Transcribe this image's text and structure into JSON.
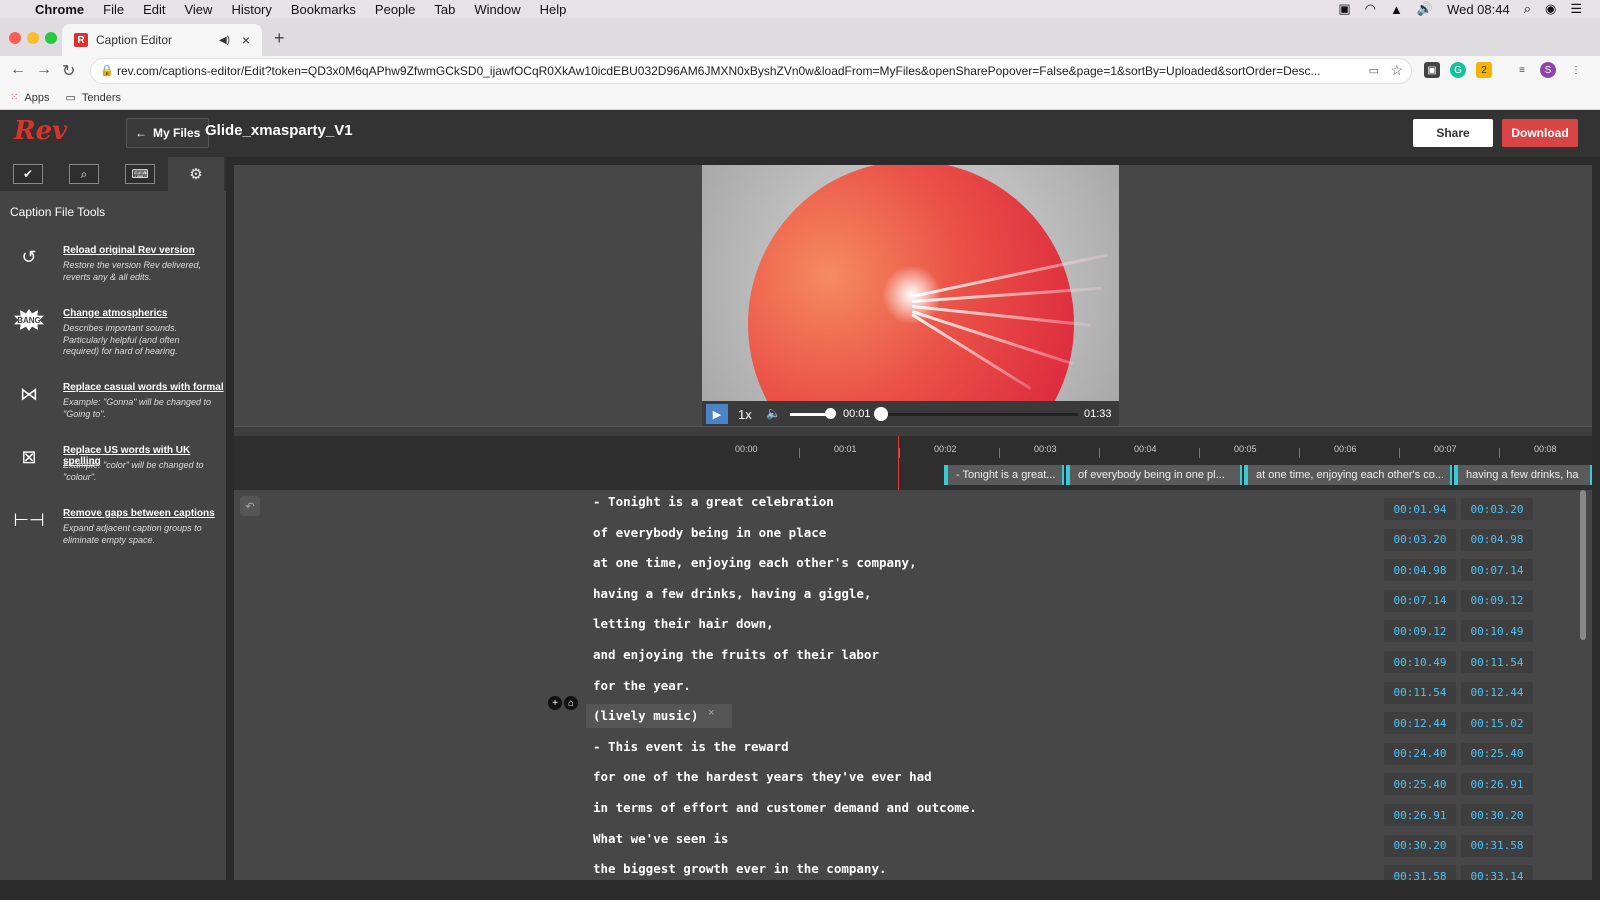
{
  "menubar": {
    "apple": "",
    "items": [
      "Chrome",
      "File",
      "Edit",
      "View",
      "History",
      "Bookmarks",
      "People",
      "Tab",
      "Window",
      "Help"
    ],
    "clock": "Wed 08:44"
  },
  "browser": {
    "tab_title": "Caption Editor",
    "favicon_letter": "R",
    "url": "rev.com/captions-editor/Edit?token=QD3x0M6qAPhw9ZfwmGCkSD0_ijawfOCqR0XkAw10icdEBU032D96AM6JMXN0xByshZVn0w&loadFrom=MyFiles&openSharePopover=False&page=1&sortBy=Uploaded&sortOrder=Desc...",
    "bookmarks": [
      "Apps",
      "Tenders"
    ]
  },
  "header": {
    "logo": "Rev",
    "back_label": "My Files",
    "filename": "Glide_xmasparty_V1",
    "share_label": "Share",
    "download_label": "Download"
  },
  "sidebar": {
    "title": "Caption File Tools",
    "tabs": [
      "check-icon",
      "search-icon",
      "keyboard-icon",
      "gear-icon"
    ],
    "tools": [
      {
        "label": "Reload original Rev version",
        "desc": "Restore the version Rev delivered, reverts any & all edits."
      },
      {
        "label": "Change atmospherics",
        "desc": "Describes important sounds. Particularly helpful (and often required) for hard of hearing."
      },
      {
        "label": "Replace casual words with formal",
        "desc": "Example: \"Gonna\" will be changed to \"Going to\"."
      },
      {
        "label": "Replace US words with UK spelling",
        "desc": "Example: \"color\" will be changed to \"colour\"."
      },
      {
        "label": "Remove gaps between captions",
        "desc": "Expand adjacent caption groups to eliminate empty space."
      }
    ],
    "bang_text": "BANG"
  },
  "player": {
    "speed": "1x",
    "current_time": "00:01",
    "total_time": "01:33",
    "volume_level": 0.9,
    "progress": 0.01
  },
  "timeline": {
    "ticks": [
      "00:00",
      "00:01",
      "00:02",
      "00:03",
      "00:04",
      "00:05",
      "00:06",
      "00:07",
      "00:08"
    ],
    "segments": [
      "- Tonight is a great...",
      "of everybody being in one pl...",
      "at one time, enjoying each other's co...",
      "having a few drinks, ha"
    ]
  },
  "captions": [
    {
      "text": "- Tonight is a great celebration",
      "start": "00:01.94",
      "end": "00:03.20"
    },
    {
      "text": "of everybody being in one place",
      "start": "00:03.20",
      "end": "00:04.98"
    },
    {
      "text": "at one time, enjoying each other's company,",
      "start": "00:04.98",
      "end": "00:07.14"
    },
    {
      "text": "having a few drinks, having a giggle,",
      "start": "00:07.14",
      "end": "00:09.12"
    },
    {
      "text": "letting their hair down,",
      "start": "00:09.12",
      "end": "00:10.49"
    },
    {
      "text": "and enjoying the fruits of their labor",
      "start": "00:10.49",
      "end": "00:11.54"
    },
    {
      "text": "for the year.",
      "start": "00:11.54",
      "end": "00:12.44"
    },
    {
      "text": "(lively music)",
      "start": "00:12.44",
      "end": "00:15.02",
      "tag": true
    },
    {
      "text": "- This event is the reward",
      "start": "00:24.40",
      "end": "00:25.40"
    },
    {
      "text": "for one of the hardest years they've ever had",
      "start": "00:25.40",
      "end": "00:26.91"
    },
    {
      "text": "in terms of effort and customer demand and outcome.",
      "start": "00:26.91",
      "end": "00:30.20"
    },
    {
      "text": "What we've seen is",
      "start": "00:30.20",
      "end": "00:31.58"
    },
    {
      "text": "the biggest growth ever in the company.",
      "start": "00:31.58",
      "end": "00:33.14"
    }
  ],
  "colors": {
    "accent_red": "#d94444",
    "timecode_blue": "#4fc3f7",
    "segment_cyan": "#3cc9d6"
  }
}
